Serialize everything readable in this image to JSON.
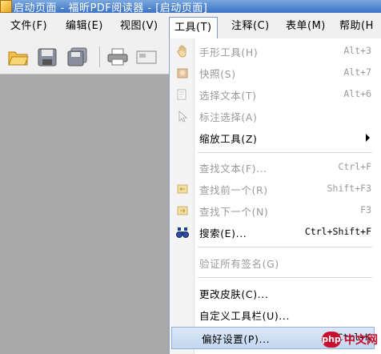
{
  "window": {
    "title": "启动页面 - 福昕PDF阅读器 - [启动页面]"
  },
  "menubar": [
    {
      "key": "file",
      "label": "文件(F)"
    },
    {
      "key": "edit",
      "label": "编辑(E)"
    },
    {
      "key": "view",
      "label": "视图(V)"
    },
    {
      "key": "tools",
      "label": "工具(T)",
      "active": true
    },
    {
      "key": "comment",
      "label": "注释(C)"
    },
    {
      "key": "form",
      "label": "表单(M)"
    },
    {
      "key": "help",
      "label": "帮助(H"
    }
  ],
  "toolbar": {
    "buttons": [
      "open-folder-icon",
      "save-icon",
      "save-as-icon",
      "print-icon",
      "email-icon"
    ]
  },
  "tools_menu": {
    "items": [
      {
        "label": "手形工具(H)",
        "shortcut": "Alt+3",
        "enabled": false,
        "icon": "hand-icon"
      },
      {
        "label": "快照(S)",
        "shortcut": "Alt+7",
        "enabled": false,
        "icon": "snapshot-icon"
      },
      {
        "label": "选择文本(T)",
        "shortcut": "Alt+6",
        "enabled": false,
        "icon": "select-text-icon"
      },
      {
        "label": "标注选择(A)",
        "shortcut": "",
        "enabled": false,
        "icon": "annotation-select-icon"
      },
      {
        "label": "缩放工具(Z)",
        "shortcut": "",
        "enabled": true,
        "submenu": true
      },
      {
        "label": "查找文本(F)...",
        "shortcut": "Ctrl+F",
        "enabled": false
      },
      {
        "label": "查找前一个(R)",
        "shortcut": "Shift+F3",
        "enabled": false,
        "icon": "find-previous-icon"
      },
      {
        "label": "查找下一个(N)",
        "shortcut": "F3",
        "enabled": false,
        "icon": "find-next-icon"
      },
      {
        "label": "搜索(E)...",
        "shortcut": "Ctrl+Shift+F",
        "enabled": true,
        "icon": "binoculars-icon"
      },
      {
        "label": "验证所有签名(G)",
        "shortcut": "",
        "enabled": false
      },
      {
        "label": "更改皮肤(C)...",
        "shortcut": "",
        "enabled": true
      },
      {
        "label": "自定义工具栏(U)...",
        "shortcut": "",
        "enabled": true
      },
      {
        "label": "偏好设置(P)...",
        "shortcut": "Ctrl+K",
        "enabled": true,
        "highlighted": true
      }
    ]
  },
  "watermark": {
    "logo": "php",
    "text": "中文网"
  },
  "colors": {
    "highlight": "#c3d7f0",
    "disabled_text": "#9a9a9a",
    "titlebar": "#3b72c4"
  }
}
